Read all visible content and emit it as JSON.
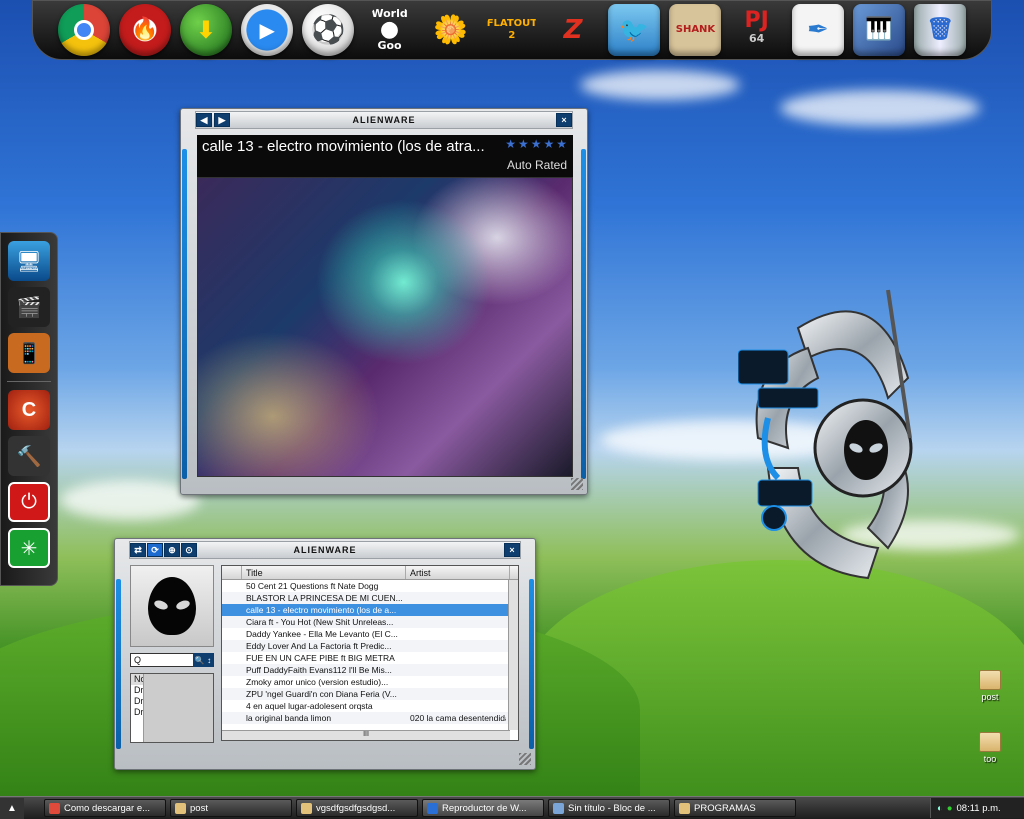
{
  "dock": {
    "items": [
      {
        "name": "Google Chrome",
        "icon": "chrome-icon"
      },
      {
        "name": "Nero",
        "icon": "flame-icon"
      },
      {
        "name": "Download Manager",
        "icon": "globe-download-icon"
      },
      {
        "name": "Media Player",
        "icon": "play-icon"
      },
      {
        "name": "Soccer Ball",
        "icon": "soccer-ball-icon"
      },
      {
        "name": "World of Goo",
        "icon": "world-of-goo-icon",
        "label_top": "World",
        "label_bottom": "Goo"
      },
      {
        "name": "Plants vs Zombies",
        "icon": "plants-zombies-icon"
      },
      {
        "name": "FlatOut 2",
        "icon": "flatout-icon",
        "label": "FLATOUT 2"
      },
      {
        "name": "Need for Speed",
        "icon": "nfs-icon"
      },
      {
        "name": "Angry Birds",
        "icon": "angry-bird-icon"
      },
      {
        "name": "Shank",
        "icon": "shank-icon",
        "label": "SHANK"
      },
      {
        "name": "Project64",
        "icon": "pj64-icon",
        "label_top": "PJ",
        "label_bottom": "64"
      },
      {
        "name": "Quill",
        "icon": "quill-icon"
      },
      {
        "name": "Piano",
        "icon": "piano-icon"
      },
      {
        "name": "Recycle Bin",
        "icon": "trash-icon"
      }
    ]
  },
  "left_dock": {
    "items": [
      {
        "icon": "monitor-icon"
      },
      {
        "icon": "clapperboard-icon"
      },
      {
        "icon": "media-device-icon"
      },
      {
        "icon": "ccleaner-icon"
      },
      {
        "icon": "tools-icon"
      },
      {
        "icon": "power-icon"
      },
      {
        "icon": "loading-icon"
      }
    ]
  },
  "player": {
    "brand": "ALIENWARE",
    "track_title": "calle 13 - electro movimiento (los de atra...",
    "rating_stars": "★★★★★",
    "rating_label": "Auto Rated",
    "nav_prev": "◀",
    "nav_next": "▶",
    "close": "×"
  },
  "library": {
    "brand": "ALIENWARE",
    "close": "×",
    "toolbar": [
      "⇄",
      "⟳",
      "⊕",
      "⊙"
    ],
    "search_value": "Q",
    "search_button": "🔍 ↕",
    "sources": [
      "Now Playing",
      "Drive I: No hay ni",
      "Drive K: No hay n",
      "Drive L: No hay n"
    ],
    "columns": [
      "Title",
      "Artist"
    ],
    "rows": [
      {
        "title": "50 Cent   21 Questions ft Nate Dogg",
        "artist": ""
      },
      {
        "title": "BLASTOR  LA PRINCESA DE MI CUEN...",
        "artist": ""
      },
      {
        "title": "calle 13 - electro movimiento (los de a...",
        "artist": ""
      },
      {
        "title": "Ciara ft - You Hot (New Shit Unreleas...",
        "artist": ""
      },
      {
        "title": "Daddy Yankee - Ella Me Levanto (El C...",
        "artist": ""
      },
      {
        "title": "Eddy Lover And La Factoria ft Predic...",
        "artist": ""
      },
      {
        "title": "FUE EN UN CAFE   PIBE ft BIG METRA",
        "artist": ""
      },
      {
        "title": "Puff DaddyFaith Evans112   I'll Be Mis...",
        "artist": ""
      },
      {
        "title": "Zmoky   amor unico (version estudio)...",
        "artist": ""
      },
      {
        "title": "ZPU 'ngel Guardi'n con Diana Feria (V...",
        "artist": ""
      },
      {
        "title": "4 en aquel lugar-adolesent orqsta",
        "artist": ""
      },
      {
        "title": "la original banda limon",
        "artist": "020 la cama desentendida"
      }
    ],
    "selected_index": 2,
    "hscroll_label": "III"
  },
  "desktop_icons": [
    {
      "label": "post"
    },
    {
      "label": "too"
    }
  ],
  "taskbar": {
    "start": "▲",
    "tasks": [
      {
        "label": "Como descargar e...",
        "icon_color": "#e04a3a"
      },
      {
        "label": "post",
        "icon_color": "#e2c27a"
      },
      {
        "label": "vgsdfgsdfgsdgsd...",
        "icon_color": "#e2c27a"
      },
      {
        "label": "Reproductor de W...",
        "icon_color": "#2a6fd6",
        "active": true
      },
      {
        "label": "Sin título - Bloc de ...",
        "icon_color": "#7aa5d6"
      },
      {
        "label": "PROGRAMAS",
        "icon_color": "#e2c27a"
      }
    ],
    "clock": "08:11 p.m."
  },
  "colors": {
    "accent": "#1d8fe6",
    "titlebar_button": "#0d3e6f",
    "selected_row": "#3d8fe0"
  }
}
